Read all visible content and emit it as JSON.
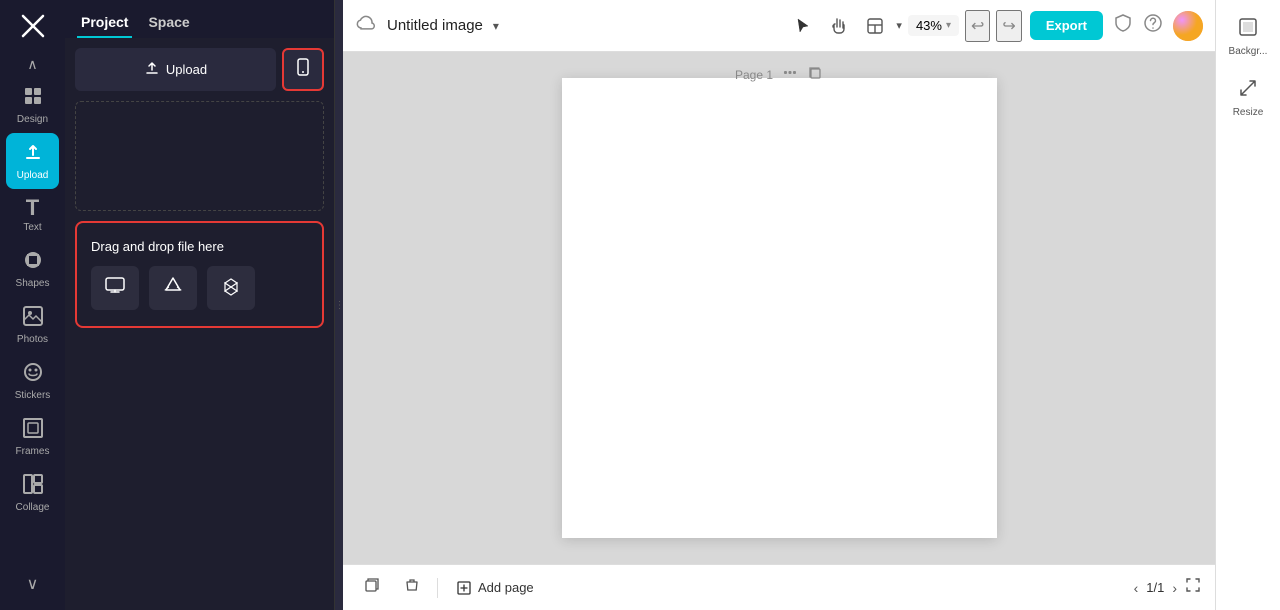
{
  "app": {
    "logo": "✕",
    "title": "Untitled image",
    "title_chevron": "▾"
  },
  "sidebar": {
    "items": [
      {
        "id": "collapse-up",
        "icon": "∧",
        "label": ""
      },
      {
        "id": "design",
        "icon": "⬡",
        "label": "Design"
      },
      {
        "id": "upload",
        "icon": "⬆",
        "label": "Upload",
        "active": true
      },
      {
        "id": "text",
        "icon": "T",
        "label": "Text"
      },
      {
        "id": "shapes",
        "icon": "◎",
        "label": "Shapes"
      },
      {
        "id": "photos",
        "icon": "⊞",
        "label": "Photos"
      },
      {
        "id": "stickers",
        "icon": "◉",
        "label": "Stickers"
      },
      {
        "id": "frames",
        "icon": "▣",
        "label": "Frames"
      },
      {
        "id": "collage",
        "icon": "⊟",
        "label": "Collage"
      },
      {
        "id": "collapse-down",
        "icon": "∨",
        "label": ""
      }
    ]
  },
  "panel": {
    "tabs": [
      {
        "id": "project",
        "label": "Project",
        "active": true
      },
      {
        "id": "space",
        "label": "Space"
      }
    ],
    "upload_button": "Upload",
    "drag_drop_title": "Drag and drop file here",
    "source_icons": [
      {
        "id": "device",
        "icon": "🖥"
      },
      {
        "id": "drive",
        "icon": "▲"
      },
      {
        "id": "dropbox",
        "icon": "◈"
      }
    ]
  },
  "toolbar": {
    "zoom": "43%",
    "export_label": "Export",
    "undo": "↩",
    "redo": "↪"
  },
  "canvas": {
    "page_label": "Page 1"
  },
  "bottom_bar": {
    "add_page": "Add page",
    "page_count": "1/1"
  },
  "right_panel": {
    "items": [
      {
        "id": "background",
        "icon": "⬚",
        "label": "Backgr..."
      },
      {
        "id": "resize",
        "icon": "⤡",
        "label": "Resize"
      }
    ]
  }
}
